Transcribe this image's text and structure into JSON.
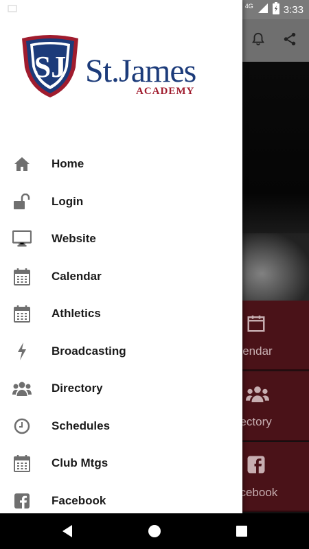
{
  "status_bar": {
    "time": "3:33",
    "network": "4G"
  },
  "logo": {
    "name": "St.James",
    "sub": "ACADEMY",
    "monogram": "SJ"
  },
  "menu": [
    {
      "label": "Home",
      "icon": "home-icon"
    },
    {
      "label": "Login",
      "icon": "unlock-icon"
    },
    {
      "label": "Website",
      "icon": "monitor-icon"
    },
    {
      "label": "Calendar",
      "icon": "calendar-icon"
    },
    {
      "label": "Athletics",
      "icon": "calendar-icon"
    },
    {
      "label": "Broadcasting",
      "icon": "bolt-icon"
    },
    {
      "label": "Directory",
      "icon": "users-icon"
    },
    {
      "label": "Schedules",
      "icon": "clock-icon"
    },
    {
      "label": "Club Mtgs",
      "icon": "calendar-icon"
    },
    {
      "label": "Facebook",
      "icon": "facebook-icon"
    }
  ],
  "background_tiles": [
    {
      "label": "alendar",
      "icon": "calendar-icon"
    },
    {
      "label": "irectory",
      "icon": "users-icon"
    },
    {
      "label": "acebook",
      "icon": "facebook-icon"
    }
  ],
  "colors": {
    "brand_blue": "#1c3b7a",
    "brand_red": "#a01c2e",
    "tile_bg": "#4a1218"
  }
}
